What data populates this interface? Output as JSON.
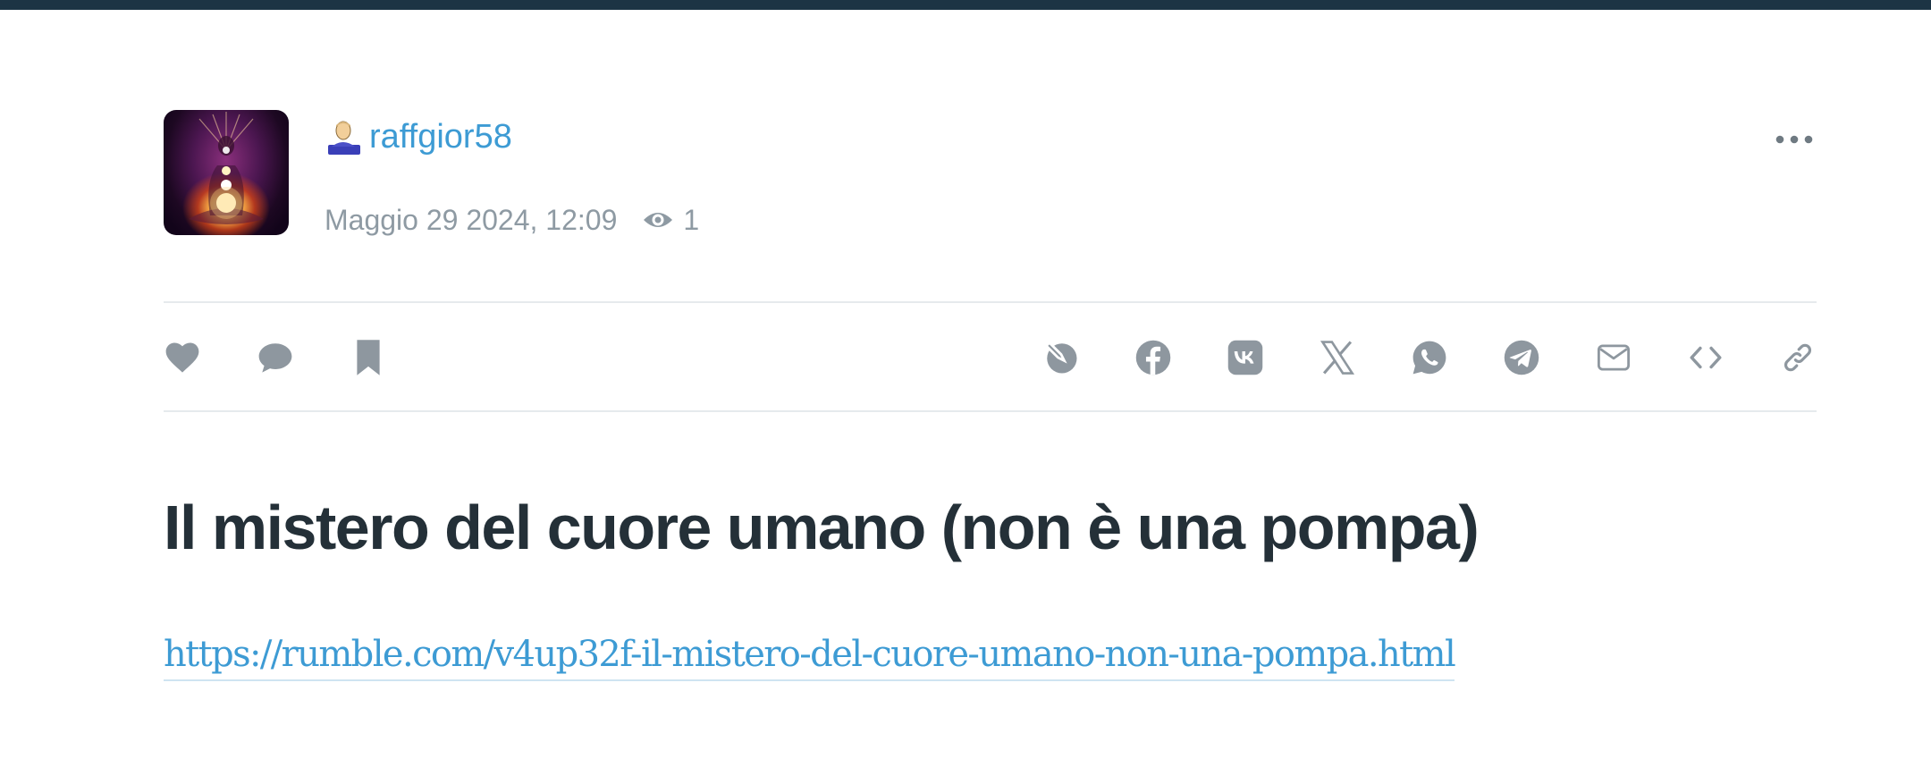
{
  "post": {
    "author": "raffgior58",
    "date": "Maggio 29 2024, 12:09",
    "views": "1",
    "title": "Il mistero del cuore umano (non è una pompa)",
    "link": "https://rumble.com/v4up32f-il-mistero-del-cuore-umano-non-una-pompa.html"
  },
  "icons": {
    "actions_left": [
      "heart-icon",
      "comment-icon",
      "bookmark-icon"
    ],
    "share": [
      "livejournal-icon",
      "facebook-icon",
      "vk-icon",
      "x-icon",
      "whatsapp-icon",
      "telegram-icon",
      "email-icon",
      "embed-icon",
      "copy-link-icon"
    ]
  },
  "colors": {
    "topbar": "#1c3444",
    "link": "#3d9bd4",
    "title": "#243038",
    "meta": "#8e9aa3",
    "icon": "#8e979f"
  }
}
